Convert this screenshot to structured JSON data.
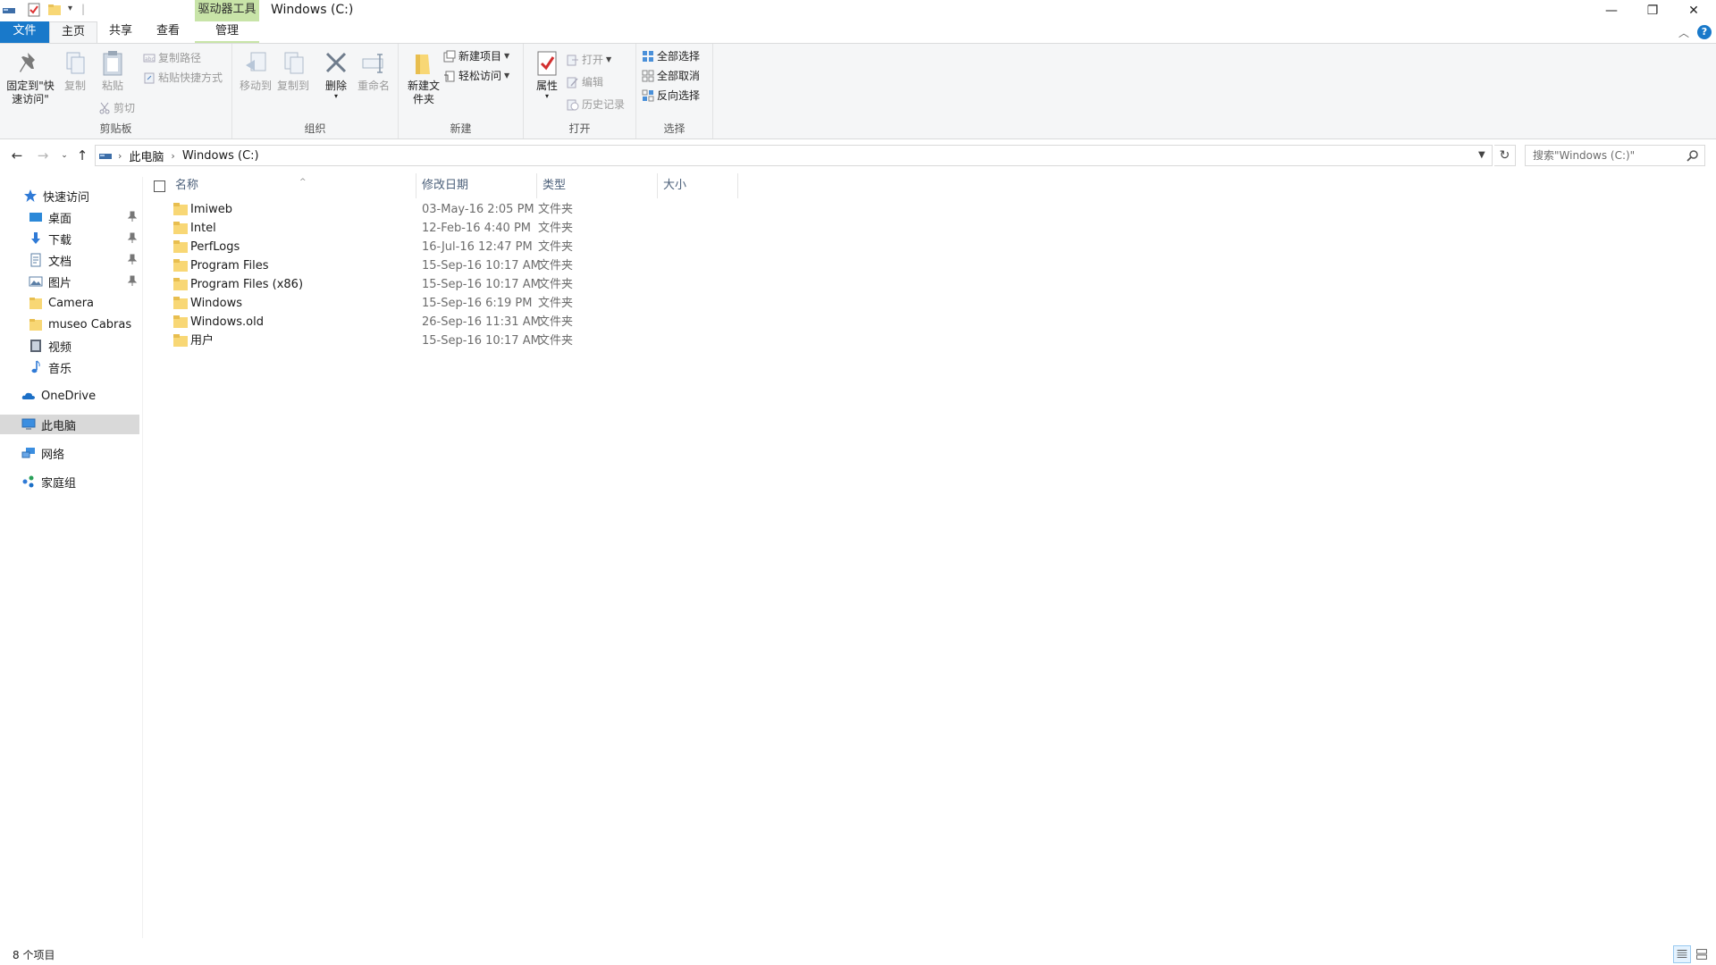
{
  "window": {
    "title": "Windows (C:)",
    "contextual_tab": "驱动器工具",
    "minimize": "—",
    "restore": "❐",
    "close": "✕"
  },
  "tabs": {
    "file": "文件",
    "home": "主页",
    "share": "共享",
    "view": "查看",
    "manage": "管理"
  },
  "ribbon": {
    "clipboard": {
      "label": "剪贴板",
      "pin": "固定到\"快速访问\"",
      "copy": "复制",
      "paste": "粘贴",
      "copy_path": "复制路径",
      "paste_shortcut": "粘贴快捷方式",
      "cut": "剪切"
    },
    "organize": {
      "label": "组织",
      "move_to": "移动到",
      "copy_to": "复制到",
      "delete": "删除",
      "rename": "重命名"
    },
    "new": {
      "label": "新建",
      "new_folder": "新建文件夹",
      "new_item": "新建项目",
      "easy_access": "轻松访问"
    },
    "open": {
      "label": "打开",
      "properties": "属性",
      "open": "打开",
      "edit": "编辑",
      "history": "历史记录"
    },
    "select": {
      "label": "选择",
      "select_all": "全部选择",
      "select_none": "全部取消",
      "invert": "反向选择"
    }
  },
  "address": {
    "crumbs": [
      "此电脑",
      "Windows (C:)"
    ],
    "search_placeholder": "搜索\"Windows (C:)\""
  },
  "nav": {
    "quick_access": "快速访问",
    "desktop": "桌面",
    "downloads": "下载",
    "documents": "文档",
    "pictures": "图片",
    "camera": "Camera",
    "museo": "museo Cabras",
    "videos": "视频",
    "music": "音乐",
    "onedrive": "OneDrive",
    "this_pc": "此电脑",
    "network": "网络",
    "homegroup": "家庭组"
  },
  "columns": {
    "name": "名称",
    "date": "修改日期",
    "type": "类型",
    "size": "大小"
  },
  "files": [
    {
      "name": "Imiweb",
      "date": "03-May-16 2:05 PM",
      "type": "文件夹"
    },
    {
      "name": "Intel",
      "date": "12-Feb-16 4:40 PM",
      "type": "文件夹"
    },
    {
      "name": "PerfLogs",
      "date": "16-Jul-16 12:47 PM",
      "type": "文件夹"
    },
    {
      "name": "Program Files",
      "date": "15-Sep-16 10:17 AM",
      "type": "文件夹"
    },
    {
      "name": "Program Files (x86)",
      "date": "15-Sep-16 10:17 AM",
      "type": "文件夹"
    },
    {
      "name": "Windows",
      "date": "15-Sep-16 6:19 PM",
      "type": "文件夹"
    },
    {
      "name": "Windows.old",
      "date": "26-Sep-16 11:31 AM",
      "type": "文件夹"
    },
    {
      "name": "用户",
      "date": "15-Sep-16 10:17 AM",
      "type": "文件夹"
    }
  ],
  "status": {
    "count": "8 个项目"
  },
  "colors": {
    "file_tab": "#1979ca",
    "contextual": "#c8e4a8",
    "folder": "#f8d775",
    "selected_nav": "#d9d9d9"
  }
}
